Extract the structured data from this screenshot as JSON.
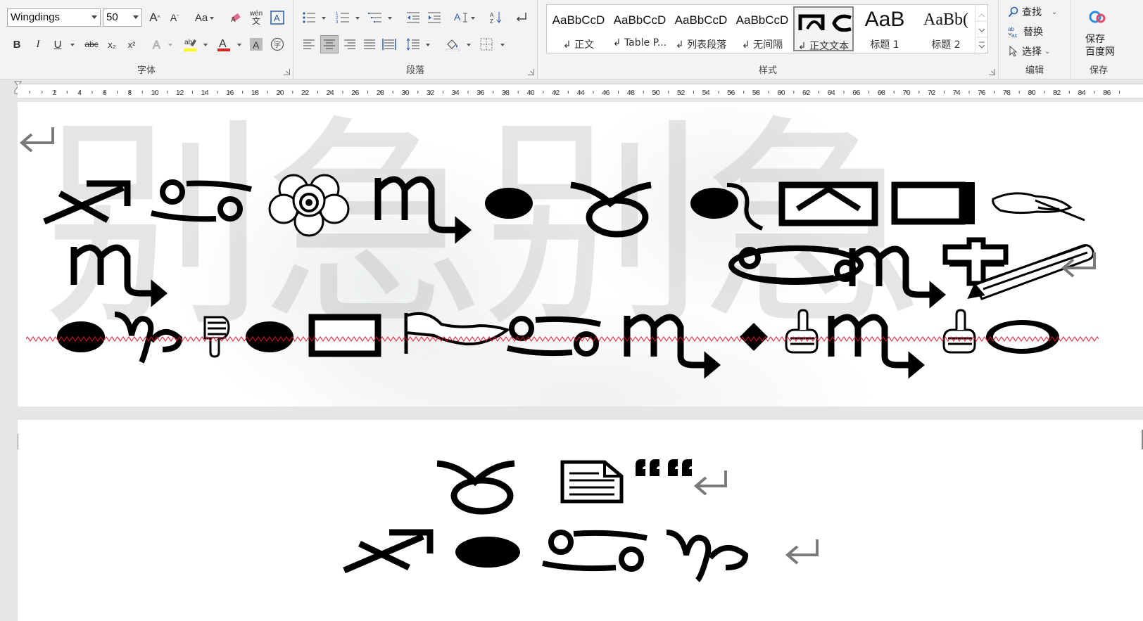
{
  "ribbon": {
    "font": {
      "group_label": "字体",
      "font_name": "Wingdings",
      "font_size": "50",
      "grow_label": "A",
      "shrink_label": "A",
      "case_label": "Aa",
      "bold": "B",
      "italic": "I",
      "underline": "U",
      "strike": "abc",
      "subscript": "x₂",
      "superscript": "x²",
      "phonetic": "wén",
      "highlight_color": "#ffff00",
      "font_color": "#e0201a"
    },
    "paragraph": {
      "group_label": "段落"
    },
    "styles": {
      "group_label": "样式",
      "items": [
        {
          "preview": "AaBbCcD",
          "name": "↲ 正文"
        },
        {
          "preview": "AaBbCcD",
          "name": "↲ Table P..."
        },
        {
          "preview": "AaBbCcD",
          "name": "↲ 列表段落"
        },
        {
          "preview": "AaBbCcD",
          "name": "↲ 无间隔"
        },
        {
          "preview": "",
          "name": "↲ 正文文本"
        },
        {
          "preview": "AaB",
          "name": "标题 1"
        },
        {
          "preview": "AaBb(",
          "name": "标题 2"
        }
      ]
    },
    "editing": {
      "group_label": "编辑",
      "find": "查找",
      "replace": "替换",
      "select": "选择"
    },
    "save": {
      "label_line1": "保存",
      "label_line2": "百度网",
      "group_label": "保存"
    }
  },
  "ruler": {
    "labels": [
      "2",
      "4",
      "6",
      "8",
      "10",
      "12",
      "14",
      "16",
      "18",
      "20",
      "22",
      "24",
      "26",
      "28",
      "30",
      "32",
      "34",
      "36",
      "38",
      "40",
      "42",
      "44",
      "46",
      "48",
      "50",
      "52",
      "54",
      "56",
      "58",
      "60",
      "62",
      "64",
      "66",
      "68",
      "70",
      "72",
      "74",
      "76",
      "78",
      "80",
      "82",
      "84",
      "86"
    ]
  },
  "document": {
    "watermark_text": "别急别急",
    "font": "Wingdings",
    "font_size": 50,
    "spellcheck_color": "#e81123"
  }
}
